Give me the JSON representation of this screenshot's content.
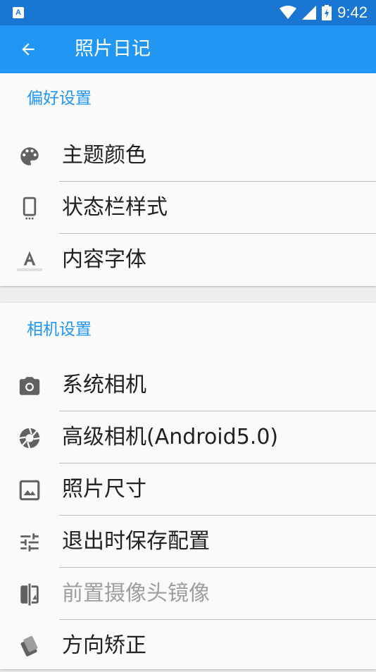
{
  "status_bar": {
    "time": "9:42",
    "notification_icon_letter": "A",
    "icons": [
      "wifi-icon",
      "signal-icon",
      "battery-icon"
    ]
  },
  "app_bar": {
    "title": "照片日记",
    "back_icon": "arrow-back-icon"
  },
  "colors": {
    "status_bar": "#1976d2",
    "app_bar": "#2196f3",
    "section_title": "#2196f3",
    "icon_gray": "#616161"
  },
  "preferences": {
    "title": "偏好设置",
    "items": [
      {
        "label": "主题颜色",
        "icon": "palette-icon"
      },
      {
        "label": "状态栏样式",
        "icon": "phone-icon"
      },
      {
        "label": "内容字体",
        "icon": "font-icon"
      }
    ]
  },
  "camera": {
    "title": "相机设置",
    "items": [
      {
        "label": "系统相机",
        "icon": "camera-icon"
      },
      {
        "label": "高级相机(Android5.0)",
        "icon": "aperture-icon"
      },
      {
        "label": "照片尺寸",
        "icon": "image-icon"
      },
      {
        "label": "退出时保存配置",
        "icon": "tune-icon"
      },
      {
        "label": "前置摄像头镜像",
        "icon": "flip-icon",
        "disabled": true
      },
      {
        "label": "方向矫正",
        "icon": "rotate-icon"
      }
    ]
  }
}
